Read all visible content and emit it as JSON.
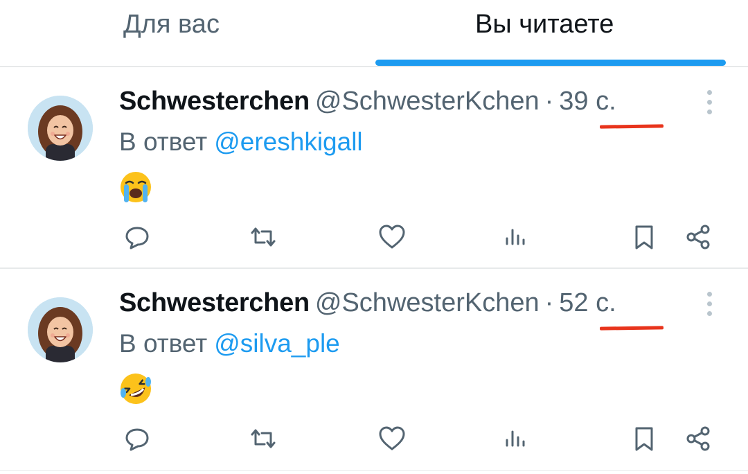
{
  "tabs": [
    {
      "label": "Для вас",
      "active": false
    },
    {
      "label": "Вы читаете",
      "active": true
    }
  ],
  "colors": {
    "accent": "#1d9bf0",
    "secondary_text": "#536471",
    "underline_marker": "#e8341c"
  },
  "tweets": [
    {
      "display_name": "Schwesterchen",
      "handle": "@SchwesterKchen",
      "separator": "·",
      "time": "39 с.",
      "reply_prefix": "В ответ",
      "reply_to": "@ereshkigall",
      "emoji": "loudly-crying-face",
      "actions": [
        "reply-icon",
        "retweet-icon",
        "like-icon",
        "views-icon",
        "bookmark-icon",
        "share-icon"
      ]
    },
    {
      "display_name": "Schwesterchen",
      "handle": "@SchwesterKchen",
      "separator": "·",
      "time": "52 с.",
      "reply_prefix": "В ответ",
      "reply_to": "@silva_ple",
      "emoji": "rolling-on-the-floor-laughing",
      "actions": [
        "reply-icon",
        "retweet-icon",
        "like-icon",
        "views-icon",
        "bookmark-icon",
        "share-icon"
      ]
    }
  ]
}
